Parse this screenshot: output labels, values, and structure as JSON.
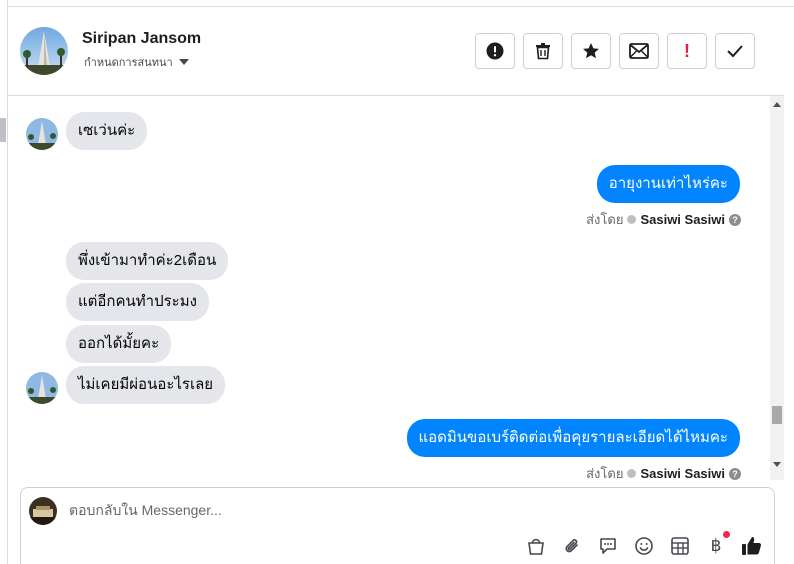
{
  "header": {
    "name": "Siripan Jansom",
    "status": "กำหนดการสนทนา",
    "actions": [
      {
        "id": "alert",
        "icon": "alert-circle-icon"
      },
      {
        "id": "delete",
        "icon": "trash-icon"
      },
      {
        "id": "star",
        "icon": "star-icon"
      },
      {
        "id": "mail",
        "icon": "envelope-icon"
      },
      {
        "id": "flag",
        "icon": "exclamation-icon",
        "text": "!"
      },
      {
        "id": "done",
        "icon": "checkmark-icon"
      }
    ]
  },
  "messages": {
    "m1": "เซเว่นค่ะ",
    "m2": "อายุงานเท่าไหร่คะ",
    "m3": "พึ่งเข้ามาทำค่ะ2เดือน",
    "m4": "แต่อีกคนทำประมง",
    "m5": "ออกได้มั้ยคะ",
    "m6": "ไม่เคยมีผ่อนอะไรเลย",
    "m7": "แอดมินขอเบร์ติดต่อเพื่อคุยรายละเอียดได้ไหมคะ"
  },
  "sent_by": {
    "label": "ส่งโดย",
    "name": "Sasiwi Sasiwi"
  },
  "composer": {
    "placeholder": "ตอบกลับใน Messenger..."
  },
  "toolbar": {
    "icons": [
      "bag-icon",
      "paperclip-icon",
      "speech-bubble-icon",
      "smiley-icon",
      "table-icon",
      "baht-icon",
      "thumbs-up-icon"
    ],
    "baht_symbol": "฿"
  },
  "colors": {
    "outgoing_bubble": "#0084ff",
    "incoming_bubble": "#e4e6eb",
    "notification_dot": "#f02849",
    "flag_red": "#e41e3f"
  }
}
